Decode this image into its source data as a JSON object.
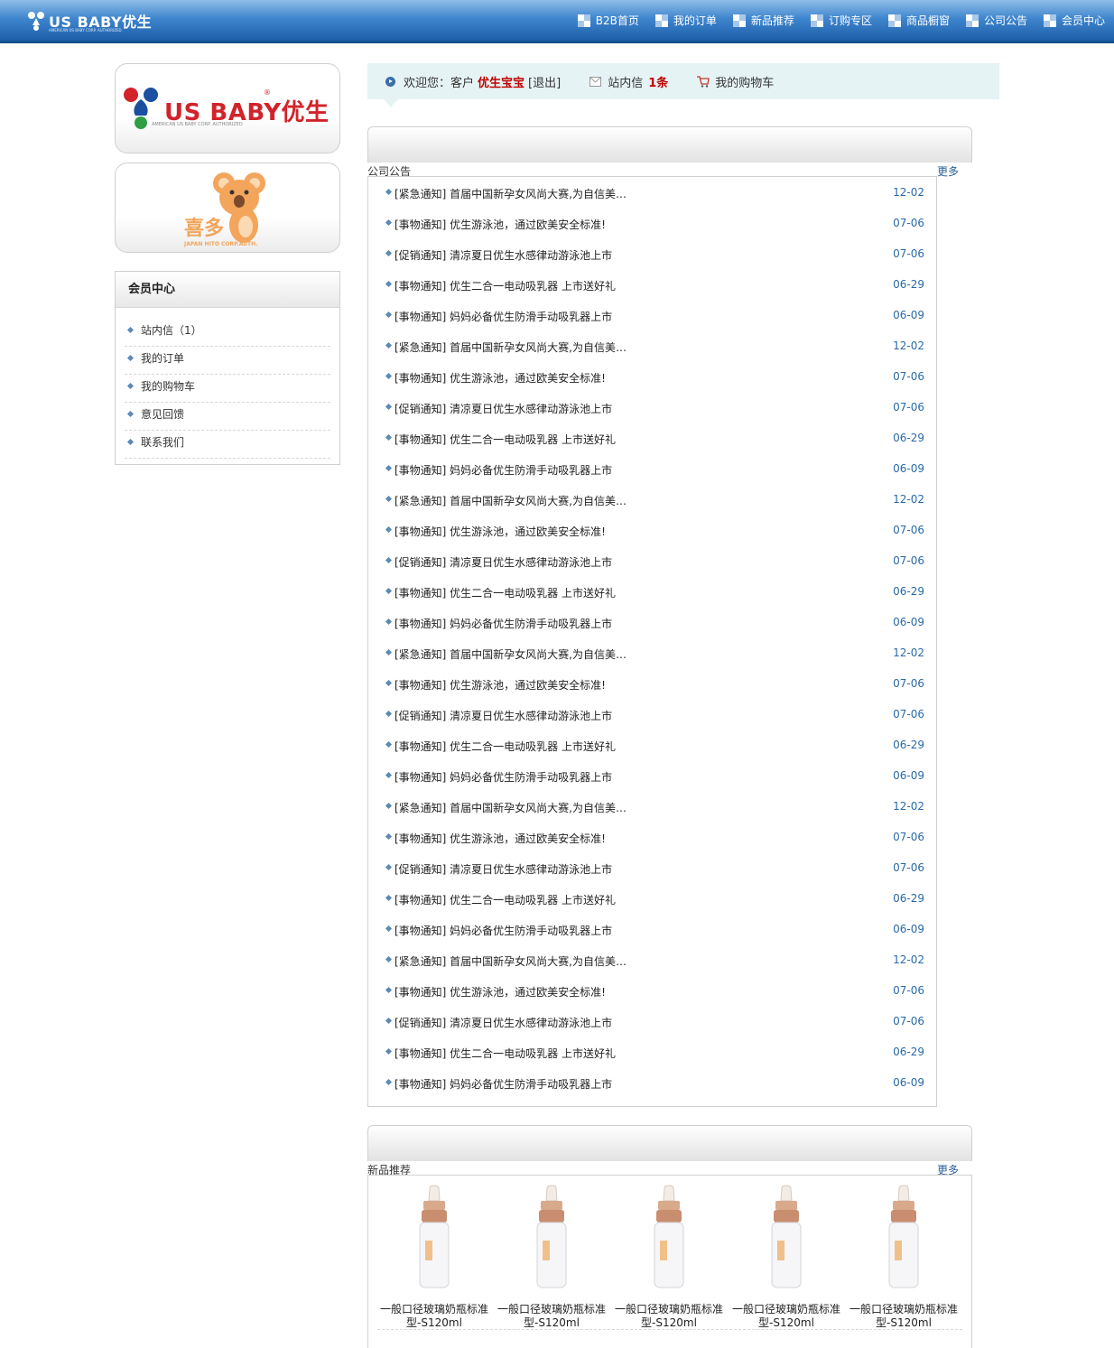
{
  "header": {
    "brand_name": "US BABY优生",
    "brand_sub": "AMERICAN US BABY CORP. AUTHORIZED",
    "nav": [
      {
        "label": "B2B首页"
      },
      {
        "label": "我的订单"
      },
      {
        "label": "新品推荐"
      },
      {
        "label": "订购专区"
      },
      {
        "label": "商品橱窗"
      },
      {
        "label": "公司公告"
      },
      {
        "label": "会员中心"
      }
    ]
  },
  "brands": {
    "usbaby": {
      "name": "US BABY优生",
      "reg": "®",
      "sub": "AMERICAN US BABY CORP. AUTHORIZED"
    },
    "hito": {
      "name_cn": "喜多",
      "sub": "JAPAN HITO CORP.AUTH."
    }
  },
  "member_center": {
    "title": "会员中心",
    "items": [
      {
        "label": "站内信（1）"
      },
      {
        "label": "我的订单"
      },
      {
        "label": "我的购物车"
      },
      {
        "label": "意见回馈"
      },
      {
        "label": "联系我们"
      }
    ]
  },
  "welcome": {
    "greeting": "欢迎您：客户",
    "username": "优生宝宝",
    "logout": "[退出]",
    "messages_label": "站内信",
    "messages_count": "1条",
    "cart_label": "我的购物车"
  },
  "notices": {
    "title": "公司公告",
    "more": "更多",
    "items": [
      {
        "title": "[紧急通知] 首届中国新孕女风尚大赛,为自信美…",
        "date": "12-02"
      },
      {
        "title": "[事物通知] 优生游泳池，通过欧美安全标准!",
        "date": "07-06"
      },
      {
        "title": "[促销通知] 清凉夏日优生水感律动游泳池上市",
        "date": "07-06"
      },
      {
        "title": "[事物通知] 优生二合一电动吸乳器 上市送好礼",
        "date": "06-29"
      },
      {
        "title": "[事物通知] 妈妈必备优生防滑手动吸乳器上市",
        "date": "06-09"
      },
      {
        "title": "[紧急通知] 首届中国新孕女风尚大赛,为自信美…",
        "date": "12-02"
      },
      {
        "title": "[事物通知] 优生游泳池，通过欧美安全标准!",
        "date": "07-06"
      },
      {
        "title": "[促销通知] 清凉夏日优生水感律动游泳池上市",
        "date": "07-06"
      },
      {
        "title": "[事物通知] 优生二合一电动吸乳器 上市送好礼",
        "date": "06-29"
      },
      {
        "title": "[事物通知] 妈妈必备优生防滑手动吸乳器上市",
        "date": "06-09"
      },
      {
        "title": "[紧急通知] 首届中国新孕女风尚大赛,为自信美…",
        "date": "12-02"
      },
      {
        "title": "[事物通知] 优生游泳池，通过欧美安全标准!",
        "date": "07-06"
      },
      {
        "title": "[促销通知] 清凉夏日优生水感律动游泳池上市",
        "date": "07-06"
      },
      {
        "title": "[事物通知] 优生二合一电动吸乳器 上市送好礼",
        "date": "06-29"
      },
      {
        "title": "[事物通知] 妈妈必备优生防滑手动吸乳器上市",
        "date": "06-09"
      },
      {
        "title": "[紧急通知] 首届中国新孕女风尚大赛,为自信美…",
        "date": "12-02"
      },
      {
        "title": "[事物通知] 优生游泳池，通过欧美安全标准!",
        "date": "07-06"
      },
      {
        "title": "[促销通知] 清凉夏日优生水感律动游泳池上市",
        "date": "07-06"
      },
      {
        "title": "[事物通知] 优生二合一电动吸乳器 上市送好礼",
        "date": "06-29"
      },
      {
        "title": "[事物通知] 妈妈必备优生防滑手动吸乳器上市",
        "date": "06-09"
      },
      {
        "title": "[紧急通知] 首届中国新孕女风尚大赛,为自信美…",
        "date": "12-02"
      },
      {
        "title": "[事物通知] 优生游泳池，通过欧美安全标准!",
        "date": "07-06"
      },
      {
        "title": "[促销通知] 清凉夏日优生水感律动游泳池上市",
        "date": "07-06"
      },
      {
        "title": "[事物通知] 优生二合一电动吸乳器 上市送好礼",
        "date": "06-29"
      },
      {
        "title": "[事物通知] 妈妈必备优生防滑手动吸乳器上市",
        "date": "06-09"
      },
      {
        "title": "[紧急通知] 首届中国新孕女风尚大赛,为自信美…",
        "date": "12-02"
      },
      {
        "title": "[事物通知] 优生游泳池，通过欧美安全标准!",
        "date": "07-06"
      },
      {
        "title": "[促销通知] 清凉夏日优生水感律动游泳池上市",
        "date": "07-06"
      },
      {
        "title": "[事物通知] 优生二合一电动吸乳器 上市送好礼",
        "date": "06-29"
      },
      {
        "title": "[事物通知] 妈妈必备优生防滑手动吸乳器上市",
        "date": "06-09"
      }
    ]
  },
  "new_products": {
    "title": "新品推荐",
    "more": "更多",
    "items": [
      {
        "name_line1": "一般口径玻璃奶瓶标准",
        "name_line2": "型-S120ml"
      },
      {
        "name_line1": "一般口径玻璃奶瓶标准",
        "name_line2": "型-S120ml"
      },
      {
        "name_line1": "一般口径玻璃奶瓶标准",
        "name_line2": "型-S120ml"
      },
      {
        "name_line1": "一般口径玻璃奶瓶标准",
        "name_line2": "型-S120ml"
      },
      {
        "name_line1": "一般口径玻璃奶瓶标准",
        "name_line2": "型-S120ml"
      }
    ]
  },
  "colors": {
    "header_blue": "#1d5ea8",
    "accent_red": "#c00000",
    "date_blue": "#2a6aa8",
    "welcome_bg": "#e6f3f5"
  }
}
